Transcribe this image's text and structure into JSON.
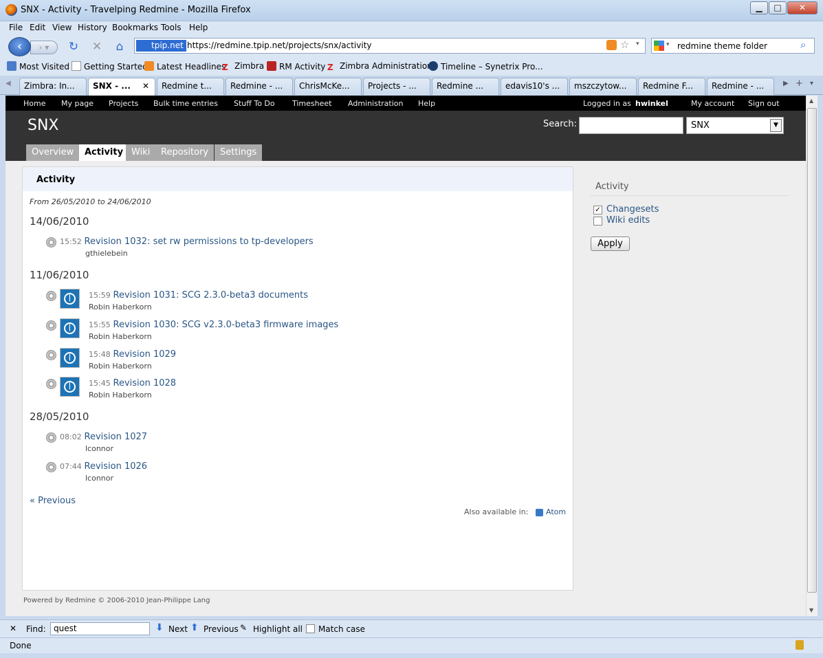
{
  "window": {
    "title": "SNX - Activity - Travelping Redmine - Mozilla Firefox"
  },
  "menubar": [
    "File",
    "Edit",
    "View",
    "History",
    "Bookmarks",
    "Tools",
    "Help"
  ],
  "navbar": {
    "site_badge": "tpip.net",
    "url": "https://redmine.tpip.net/projects/snx/activity",
    "search_value": "redmine theme folder"
  },
  "bookmarks": [
    "Most Visited",
    "Getting Started",
    "Latest Headlines",
    "Zimbra",
    "RM Activity",
    "Zimbra Administration",
    "Timeline – Synetrix Pro..."
  ],
  "tabs": [
    "Zimbra: In...",
    "SNX - ...",
    "Redmine t...",
    "Redmine - ...",
    "ChrisMcKe...",
    "Projects - ...",
    "Redmine ...",
    "edavis10's ...",
    "mszczytow...",
    "Redmine F...",
    "Redmine - ..."
  ],
  "topmenu": {
    "items": [
      "Home",
      "My page",
      "Projects",
      "Bulk time entries",
      "Stuff To Do",
      "Timesheet",
      "Administration",
      "Help"
    ],
    "logged_in_as": "Logged in as",
    "user": "hwinkel",
    "my_account": "My account",
    "sign_out": "Sign out"
  },
  "header": {
    "project": "SNX",
    "search_label": "Search:",
    "project_select": "SNX"
  },
  "project_tabs": [
    "Overview",
    "Activity",
    "Wiki",
    "Repository",
    "Settings"
  ],
  "content": {
    "title": "Activity",
    "range": "From 26/05/2010 to 24/06/2010",
    "days": [
      {
        "date": "14/06/2010",
        "events": [
          {
            "time": "15:52",
            "title": "Revision 1032: set rw permissions to tp-developers",
            "author": "gthielebein"
          }
        ]
      },
      {
        "date": "11/06/2010",
        "events": [
          {
            "time": "15:59",
            "title": "Revision 1031: SCG 2.3.0-beta3 documents",
            "author": "Robin Haberkorn"
          },
          {
            "time": "15:55",
            "title": "Revision 1030: SCG v2.3.0-beta3 firmware images",
            "author": "Robin Haberkorn"
          },
          {
            "time": "15:48",
            "title": "Revision 1029",
            "author": "Robin Haberkorn"
          },
          {
            "time": "15:45",
            "title": "Revision 1028",
            "author": "Robin Haberkorn"
          }
        ]
      },
      {
        "date": "28/05/2010",
        "events": [
          {
            "time": "08:02",
            "title": "Revision 1027",
            "author": "lconnor"
          },
          {
            "time": "07:44",
            "title": "Revision 1026",
            "author": "lconnor"
          }
        ]
      }
    ],
    "previous": "« Previous",
    "also_available": "Also available in:",
    "atom": "Atom"
  },
  "sidebar": {
    "title": "Activity",
    "filters": [
      {
        "label": "Changesets",
        "checked": true
      },
      {
        "label": "Wiki edits",
        "checked": false
      }
    ],
    "apply": "Apply"
  },
  "footer": "Powered by Redmine © 2006-2010 Jean-Philippe Lang",
  "findbar": {
    "label": "Find:",
    "value": "quest",
    "next": "Next",
    "previous": "Previous",
    "highlight": "Highlight all",
    "match_case": "Match case"
  },
  "status": "Done"
}
